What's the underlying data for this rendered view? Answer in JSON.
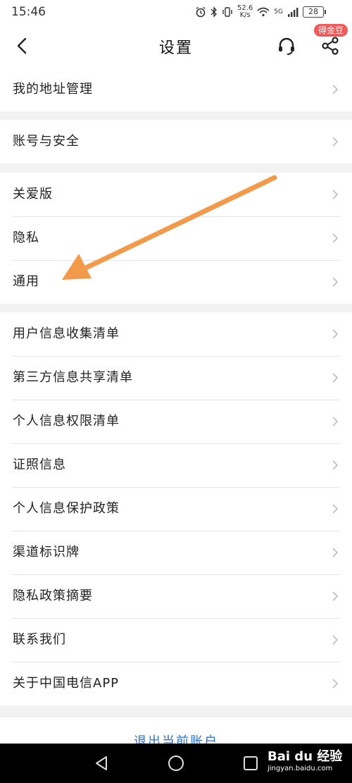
{
  "status_bar": {
    "time": "15:46",
    "net_speed_value": "52.6",
    "net_speed_unit": "K/s",
    "signal_type": "5G",
    "battery": "28",
    "icons": [
      "alarm-icon",
      "bluetooth-icon",
      "vibrate-icon",
      "wifi-icon",
      "signal-icon",
      "battery-icon"
    ]
  },
  "header": {
    "title": "设置",
    "coin_badge": "得金豆",
    "icons": [
      "back-arrow-icon",
      "headset-icon",
      "share-icon"
    ]
  },
  "groups": [
    {
      "items": [
        "我的地址管理"
      ]
    },
    {
      "items": [
        "账号与安全"
      ]
    },
    {
      "items": [
        "关爱版",
        "隐私",
        "通用"
      ]
    },
    {
      "items": [
        "用户信息收集清单",
        "第三方信息共享清单",
        "个人信息权限清单",
        "证照信息",
        "个人信息保护政策",
        "渠道标识牌",
        "隐私政策摘要",
        "联系我们",
        "关于中国电信APP"
      ]
    }
  ],
  "logout_label": "退出当前账户",
  "nav_bar": {
    "icons": [
      "back-triangle-icon",
      "home-circle-icon",
      "recents-square-icon"
    ]
  },
  "watermark": {
    "main": "Bai du 经验",
    "sub": "jingyan.baidu.com"
  },
  "colors": {
    "accent_blue": "#2a6fd6",
    "badge_red": "#f15a5a",
    "annotation_arrow": "#f39a4a",
    "page_bg": "#f2f2f2"
  }
}
